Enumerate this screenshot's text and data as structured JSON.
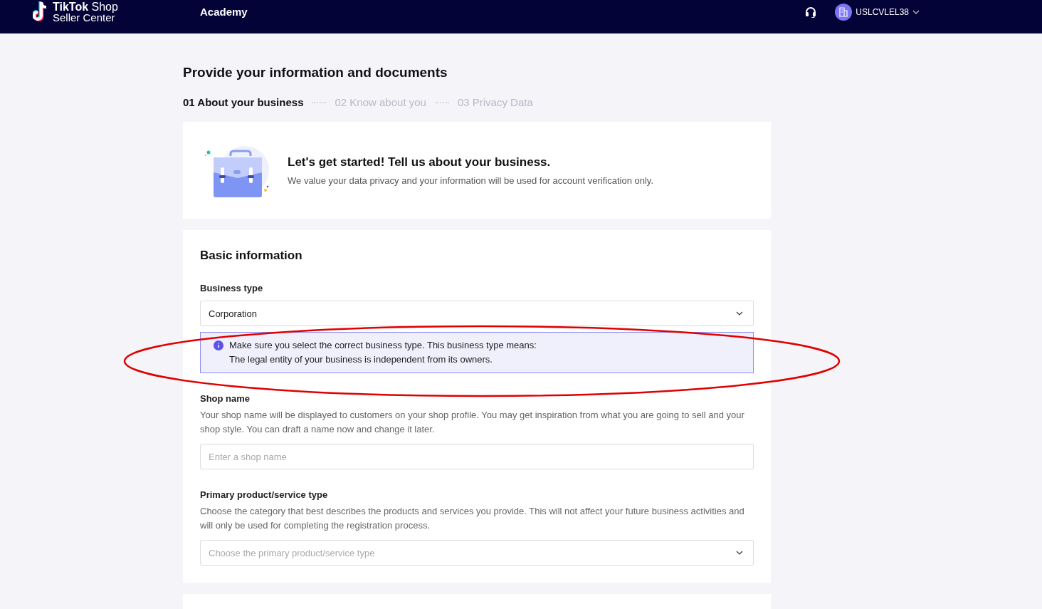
{
  "header": {
    "logo_title": "TikTok",
    "logo_title_light": "Shop",
    "logo_subtitle": "Seller Center",
    "nav": [
      {
        "label": "Academy"
      }
    ],
    "account": "USLCVLEL38"
  },
  "page_title": "Provide your information and documents",
  "steps": [
    {
      "label": "01 About your business",
      "selected": true
    },
    {
      "label": "02 Know about you",
      "selected": false
    },
    {
      "label": "03 Privacy Data",
      "selected": false
    }
  ],
  "intro": {
    "title": "Let's get started! Tell us about your business.",
    "text": "We value your data privacy and your information will be used for account verification only."
  },
  "basic_information": {
    "title": "Basic information",
    "fields": [
      {
        "kind": "select",
        "label": "Business type",
        "value": "Corporation",
        "notice": [
          "Make sure you select the correct business type. This business type means:",
          "The legal entity of your business is independent from its owners."
        ]
      },
      {
        "kind": "input",
        "label": "Shop name",
        "description": "Your shop name will be displayed to customers on your shop profile. You may get inspiration from what you are going to sell and your shop style. You can draft a name now and change it later.",
        "placeholder": "Enter a shop name"
      },
      {
        "kind": "select",
        "label": "Primary product/service type",
        "description": "Choose the category that best describes the products and services you provide. This will not affect your future business activities and will only be used for completing the registration process.",
        "placeholder": "Choose the primary product/service type"
      }
    ]
  }
}
